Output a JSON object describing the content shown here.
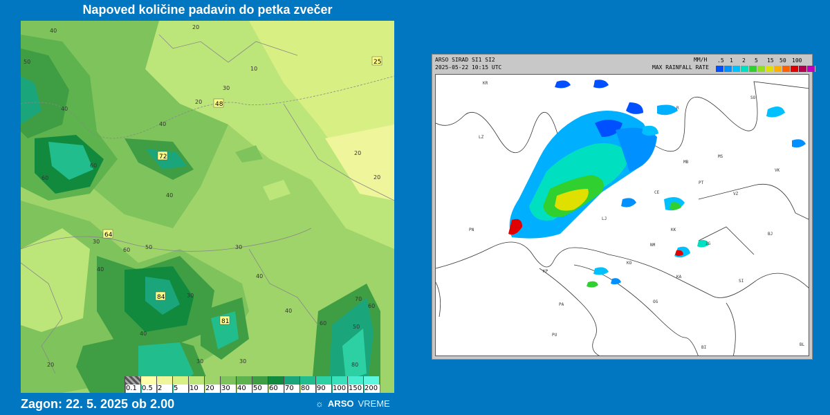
{
  "forecast": {
    "title": "Napoved količine padavin do petka zvečer",
    "run_label": "Zagon: 22. 5. 2025 ob 2.00",
    "legend": [
      {
        "label": "0.1",
        "color": "#8a8a8a"
      },
      {
        "label": "0.5",
        "color": "#ffffaa"
      },
      {
        "label": "2",
        "color": "#eef59a"
      },
      {
        "label": "5",
        "color": "#d8ef84"
      },
      {
        "label": "10",
        "color": "#bde67a"
      },
      {
        "label": "20",
        "color": "#9fd46a"
      },
      {
        "label": "30",
        "color": "#7fc35c"
      },
      {
        "label": "40",
        "color": "#5eb34e"
      },
      {
        "label": "50",
        "color": "#3f9e44"
      },
      {
        "label": "60",
        "color": "#128a3e"
      },
      {
        "label": "70",
        "color": "#1aa67a"
      },
      {
        "label": "80",
        "color": "#22bd8c"
      },
      {
        "label": "90",
        "color": "#2cd0a3"
      },
      {
        "label": "100",
        "color": "#38e0bb"
      },
      {
        "label": "150",
        "color": "#46eccd"
      },
      {
        "label": "200",
        "color": "#5cf6de"
      }
    ],
    "max_values": [
      "25",
      "48",
      "72",
      "64",
      "84",
      "81"
    ],
    "contour_labels": [
      "40",
      "10",
      "20",
      "20",
      "30",
      "50",
      "40",
      "40",
      "60",
      "20",
      "20",
      "40",
      "60",
      "30",
      "30",
      "40",
      "50",
      "30",
      "60",
      "40",
      "40",
      "70",
      "60",
      "60",
      "50",
      "80",
      "40",
      "30",
      "20",
      "30"
    ]
  },
  "brand": {
    "name": "ARSO",
    "suffix": "VREME",
    "icon": "sun-icon"
  },
  "radar": {
    "header_left_1": "ARSO SIRAD SI1 SI2",
    "header_left_2": "2025-05-22 10:15 UTC",
    "units": "MM/H",
    "rate_label": "MAX RAINFALL RATE",
    "scale_ticks": [
      ".5",
      "1",
      "2",
      "5",
      "15",
      "50",
      "100"
    ],
    "scale_colors": [
      "#0050ff",
      "#0090ff",
      "#00c0ff",
      "#00e0c0",
      "#30d030",
      "#90e020",
      "#e0e000",
      "#ffb000",
      "#ff6000",
      "#e00000",
      "#b00050",
      "#c000c0"
    ],
    "cities": [
      "LZ",
      "SO",
      "MS",
      "MB",
      "PT",
      "VZ",
      "CE",
      "LJ",
      "KK",
      "NM",
      "ZG",
      "BJ",
      "VK",
      "PN",
      "KP",
      "KO",
      "KA",
      "SI",
      "PA",
      "OG",
      "PU",
      "BI",
      "BL",
      "R",
      "KR"
    ]
  }
}
